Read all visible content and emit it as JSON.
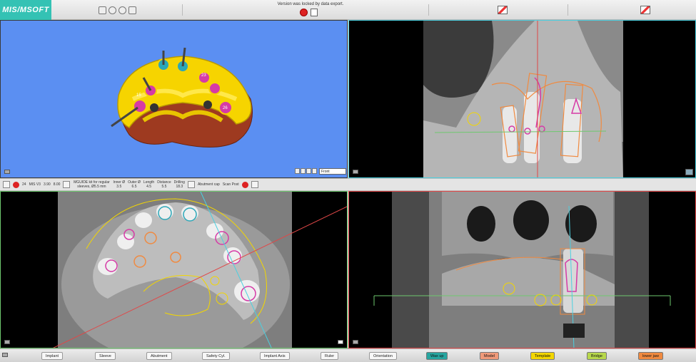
{
  "app": {
    "logo": "MIS/MSOFT",
    "locked_message": "Version was locked by data export."
  },
  "infobar": {
    "tooth": "24",
    "system": "MIS V3",
    "diameter": "3.90",
    "length": "8.00",
    "kit": "MGUIDE kit for regular sleeves, Ø5.5 mm",
    "inner": {
      "label": "Inner Ø",
      "value": "3.5"
    },
    "outer": {
      "label": "Outer Ø",
      "value": "6.5"
    },
    "len": {
      "label": "Length",
      "value": "4.5"
    },
    "distance": {
      "label": "Distance",
      "value": "5.5"
    },
    "drilling": {
      "label": "Drilling",
      "value": "18.3"
    },
    "abutment_cap": "Abutment cap",
    "scan_post": "Scan Post"
  },
  "view_dropdown": {
    "value": "Front"
  },
  "bottom_buttons": {
    "implant": "Implant",
    "sleeve": "Sleeve",
    "abutment": "Abutment",
    "safety": "Safety Cyl.",
    "implant_axis": "Implant Axis",
    "ruler": "Ruler",
    "orientation": "Orientation",
    "wax_up": "Wax up",
    "model": "Model",
    "template": "Template",
    "bridge": "Bridge",
    "lower_jaw": "lower jaw"
  },
  "colors": {
    "wax_up": "#27a5a0",
    "model": "#f09a7a",
    "template": "#f3d600",
    "bridge": "#b8d84c",
    "lower_jaw": "#f08a40"
  },
  "tooth_labels": [
    "15",
    "23",
    "26"
  ]
}
